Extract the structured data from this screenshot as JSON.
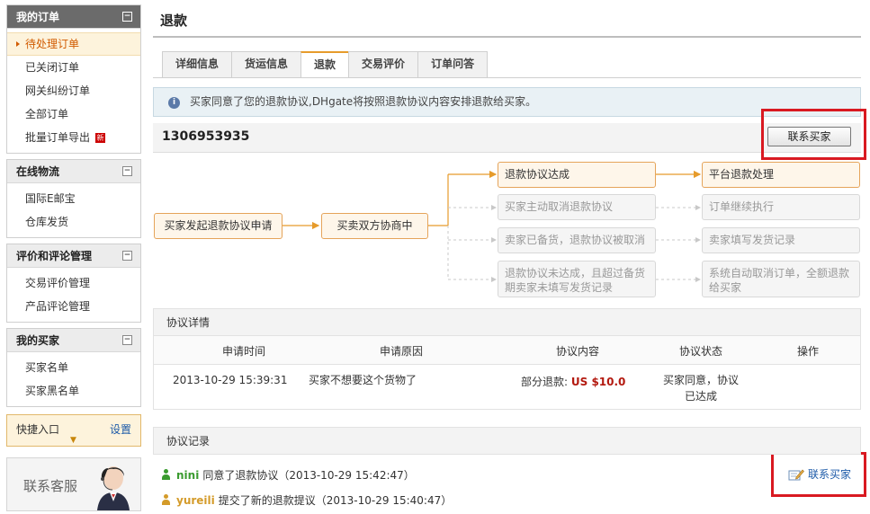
{
  "sidebar": {
    "groups": [
      {
        "title": "我的订单",
        "items": [
          {
            "label": "待处理订单",
            "active": true
          },
          {
            "label": "已关闭订单"
          },
          {
            "label": "网关纠纷订单"
          },
          {
            "label": "全部订单"
          },
          {
            "label": "批量订单导出",
            "badge": "新"
          }
        ]
      },
      {
        "title": "在线物流",
        "items": [
          {
            "label": "国际E邮宝"
          },
          {
            "label": "仓库发货"
          }
        ]
      },
      {
        "title": "评价和评论管理",
        "items": [
          {
            "label": "交易评价管理"
          },
          {
            "label": "产品评论管理"
          }
        ]
      },
      {
        "title": "我的买家",
        "items": [
          {
            "label": "买家名单"
          },
          {
            "label": "买家黑名单"
          }
        ]
      }
    ],
    "quick": {
      "label": "快捷入口",
      "settings": "设置"
    },
    "service": {
      "label": "联系客服"
    }
  },
  "main": {
    "title": "退款",
    "tabs": [
      "详细信息",
      "货运信息",
      "退款",
      "交易评价",
      "订单问答"
    ],
    "active_tab": 2,
    "notice": "买家同意了您的退款协议,DHgate将按照退款协议内容安排退款给买家。",
    "order_number": "1306953935",
    "contact_button": "联系买家"
  },
  "flow": {
    "start": "买家发起退款协议申请",
    "negotiate": "买卖双方协商中",
    "options": [
      {
        "label": "退款协议达成",
        "active": true
      },
      {
        "label": "买家主动取消退款协议"
      },
      {
        "label": "卖家已备货，退款协议被取消"
      },
      {
        "label": "退款协议未达成，且超过备货期卖家未填写发货记录"
      }
    ],
    "results": [
      {
        "label": "平台退款处理",
        "active": true
      },
      {
        "label": "订单继续执行"
      },
      {
        "label": "卖家填写发货记录"
      },
      {
        "label": "系统自动取消订单，全额退款给买家"
      }
    ]
  },
  "agreement": {
    "section_title": "协议详情",
    "columns": [
      "申请时间",
      "申请原因",
      "协议内容",
      "协议状态",
      "操作"
    ],
    "row": {
      "time": "2013-10-29 15:39:31",
      "reason": "买家不想要这个货物了",
      "content_label": "部分退款:",
      "content_amount": "US $10.0",
      "status": "买家同意，协议已达成",
      "action": ""
    }
  },
  "records": {
    "section_title": "协议记录",
    "entries": [
      {
        "user": "nini",
        "text": "同意了退款协议（2013-10-29 15:42:47）",
        "color": "#3a9b2f"
      },
      {
        "user": "yureili",
        "text": "提交了新的退款提议（2013-10-29 15:40:47）",
        "color": "#d49b2a"
      }
    ],
    "contact_link": "联系买家"
  },
  "colors": {
    "accent": "#e69b2b",
    "highlight_box": "#d91921",
    "link": "#1c5aa8",
    "price": "#b3190f"
  }
}
